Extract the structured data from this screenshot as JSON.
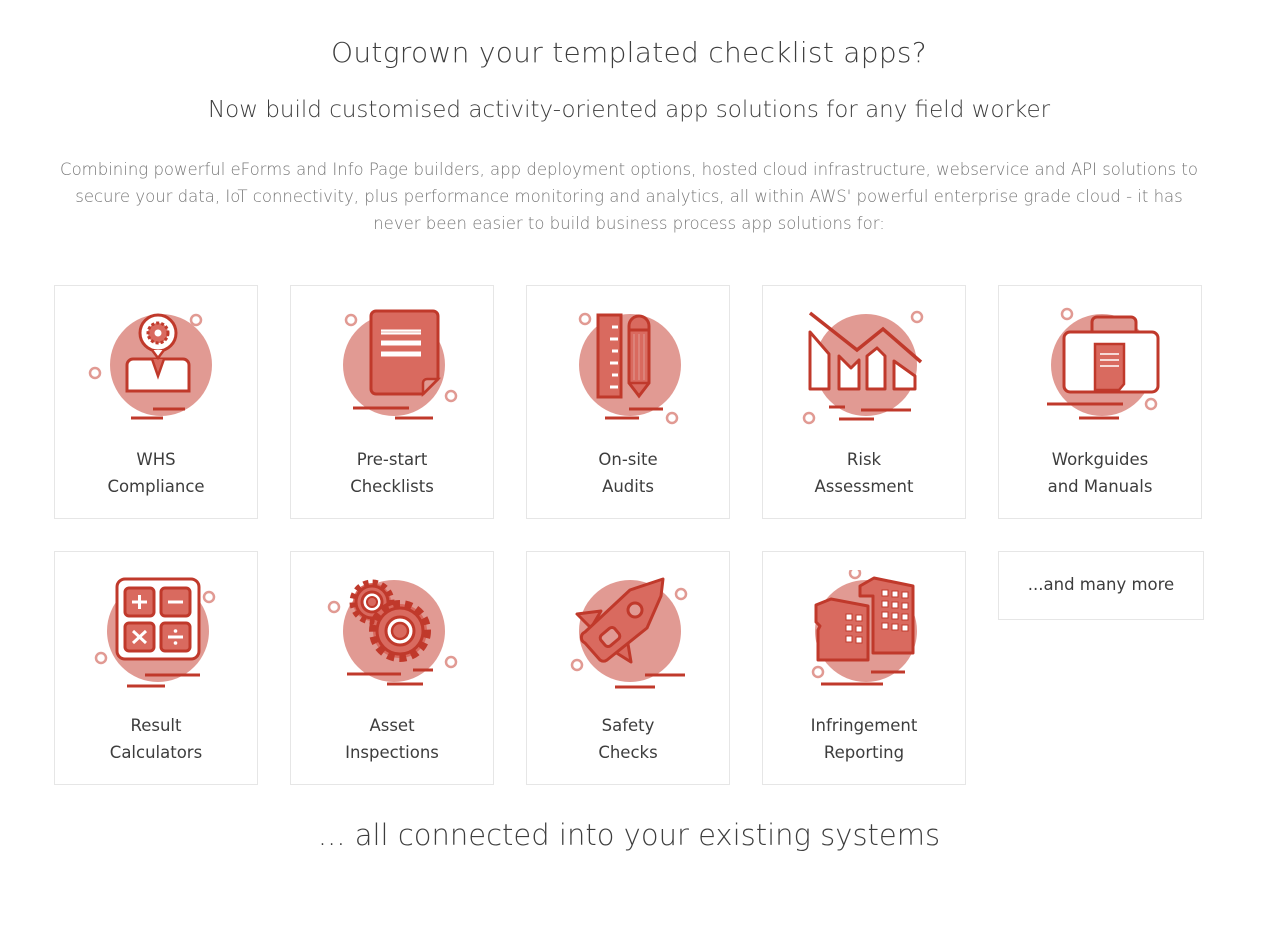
{
  "header": {
    "title": "Outgrown your templated checklist apps?",
    "subtitle": "Now build customised activity-oriented app solutions for any field worker",
    "intro": "Combining powerful eForms and Info Page builders, app deployment options, hosted cloud infrastructure, webservice and API solutions to secure your data, IoT connectivity, plus performance monitoring and analytics, all within AWS' powerful enterprise grade cloud - it has never been easier to build business process app solutions for:"
  },
  "colors": {
    "accent": "#c0392b",
    "accent_fill": "#d96a5f",
    "circle": "#e19a93",
    "text": "#3d3d3d",
    "muted": "#777777"
  },
  "cards": [
    {
      "icon": "worker-gear-icon",
      "line1": "WHS",
      "line2": "Compliance"
    },
    {
      "icon": "document-icon",
      "line1": "Pre-start",
      "line2": "Checklists"
    },
    {
      "icon": "ruler-pencil-icon",
      "line1": "On-site",
      "line2": "Audits"
    },
    {
      "icon": "declining-chart-icon",
      "line1": "Risk",
      "line2": "Assessment"
    },
    {
      "icon": "briefcase-icon",
      "line1": "Workguides",
      "line2": "and Manuals"
    },
    {
      "icon": "calculator-icon",
      "line1": "Result",
      "line2": "Calculators"
    },
    {
      "icon": "gears-icon",
      "line1": "Asset",
      "line2": "Inspections"
    },
    {
      "icon": "rocket-icon",
      "line1": "Safety",
      "line2": "Checks"
    },
    {
      "icon": "buildings-icon",
      "line1": "Infringement",
      "line2": "Reporting"
    }
  ],
  "more_label": "...and many more",
  "footer": "... all connected into your existing systems"
}
